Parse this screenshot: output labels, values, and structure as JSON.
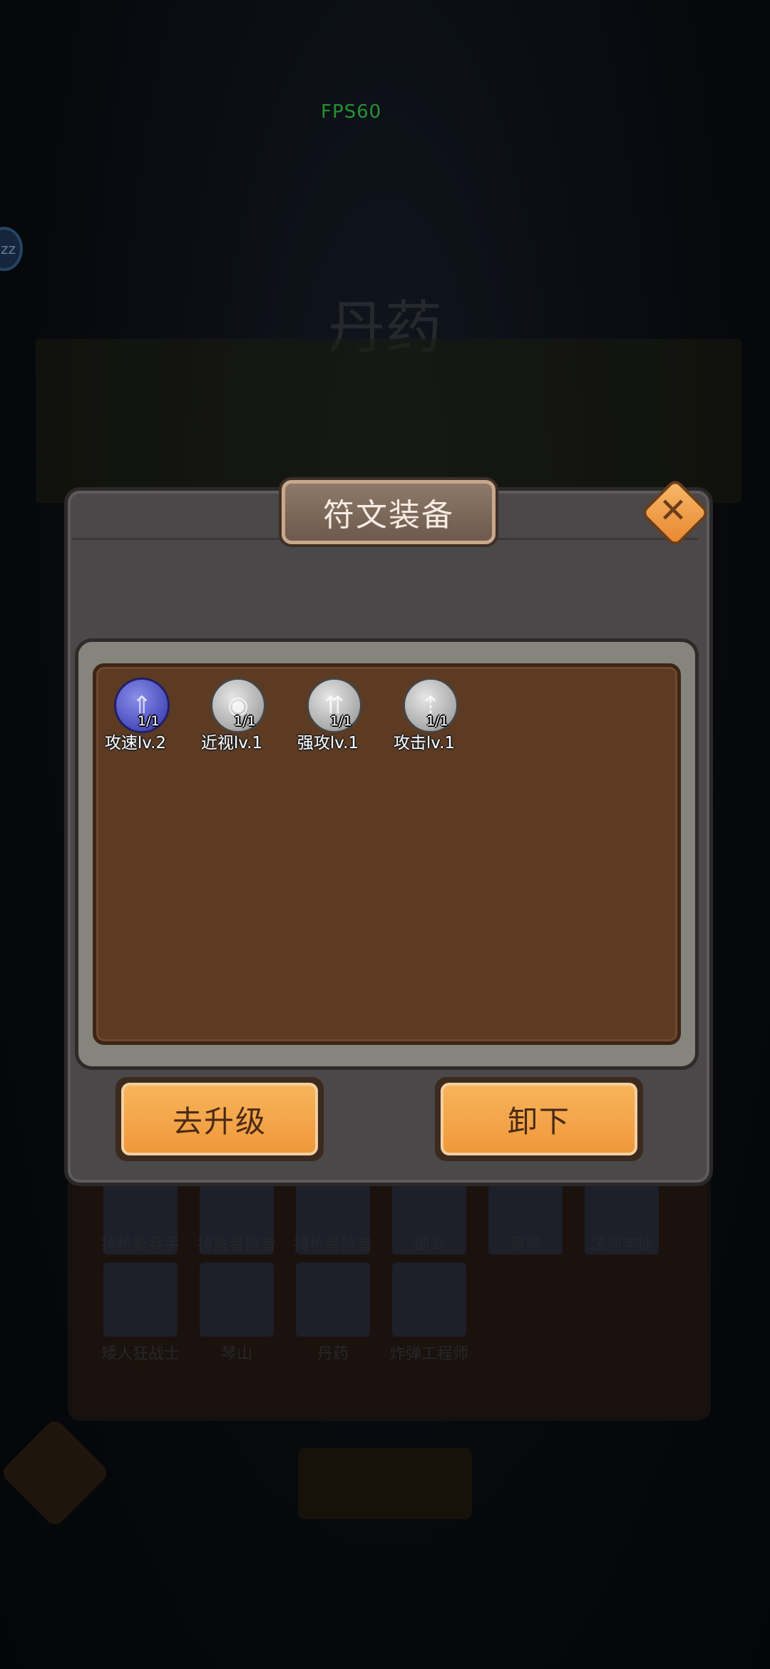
{
  "hud": {
    "fps": "FPS60",
    "sleep_badge": "zz"
  },
  "background": {
    "title": "丹药",
    "characters": [
      {
        "name": "持枪新兵手"
      },
      {
        "name": "持盾者持者"
      },
      {
        "name": "持枪者持者"
      },
      {
        "name": "御剑"
      },
      {
        "name": "黑鸦"
      },
      {
        "name": "法师学徒"
      },
      {
        "name": "矮人狂战士"
      },
      {
        "name": "琴山"
      },
      {
        "name": "丹药"
      },
      {
        "name": "炸弹工程师"
      }
    ]
  },
  "dialog": {
    "title": "符文装备",
    "runes": [
      {
        "label": "攻速lv.2",
        "count": "1/1",
        "color": "blue",
        "icon": "attack-speed-rune-icon"
      },
      {
        "label": "近视lv.1",
        "count": "1/1",
        "color": "grey",
        "icon": "eye-rune-icon"
      },
      {
        "label": "强攻lv.1",
        "count": "1/1",
        "color": "grey",
        "icon": "power-attack-rune-icon"
      },
      {
        "label": "攻击lv.1",
        "count": "1/1",
        "color": "grey",
        "icon": "attack-rune-icon"
      }
    ],
    "upgrade_label": "去升级",
    "unequip_label": "卸下"
  }
}
